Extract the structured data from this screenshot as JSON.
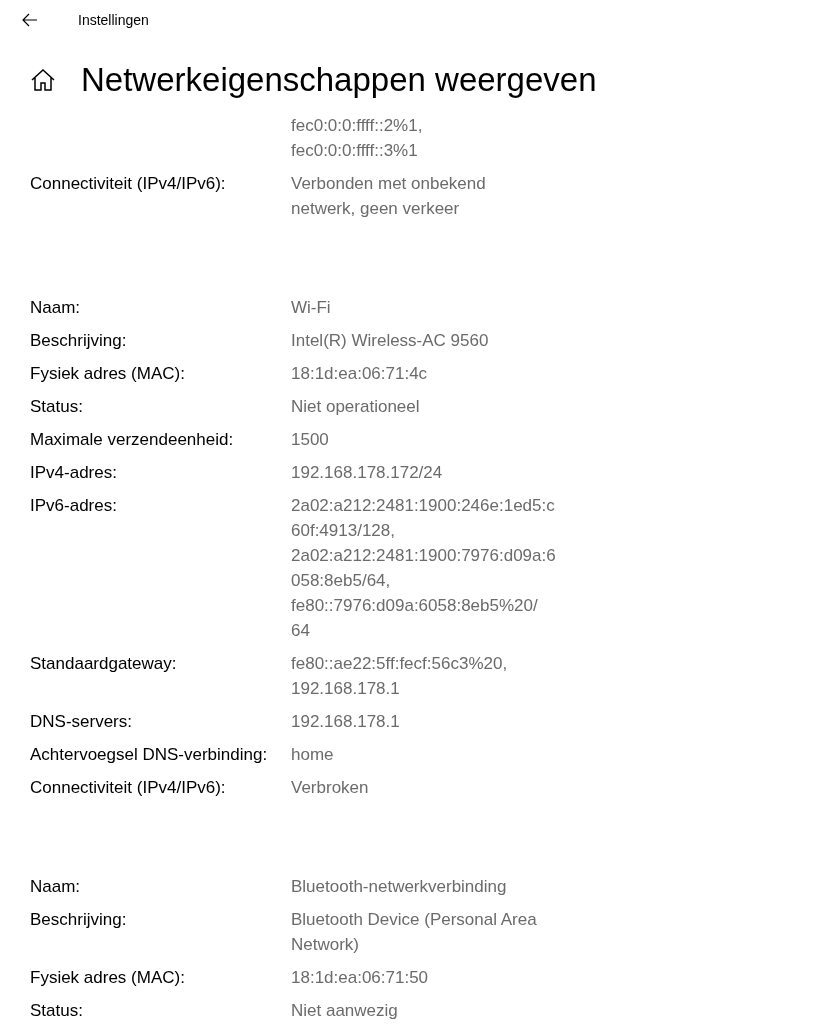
{
  "header": {
    "back_label": "Instellingen"
  },
  "page": {
    "title": "Netwerkeigenschappen weergeven"
  },
  "sections": [
    {
      "rows": [
        {
          "label": "",
          "value": [
            "fec0:0:0:ffff::2%1,",
            "fec0:0:0:ffff::3%1"
          ]
        },
        {
          "label": "Connectiviteit (IPv4/IPv6):",
          "value": [
            "Verbonden met onbekend",
            "netwerk, geen verkeer"
          ]
        }
      ]
    },
    {
      "rows": [
        {
          "label": "Naam:",
          "value": [
            "Wi-Fi"
          ]
        },
        {
          "label": "Beschrijving:",
          "value": [
            "Intel(R) Wireless-AC 9560"
          ]
        },
        {
          "label": "Fysiek adres (MAC):",
          "value": [
            "18:1d:ea:06:71:4c"
          ]
        },
        {
          "label": "Status:",
          "value": [
            "Niet operationeel"
          ]
        },
        {
          "label": "Maximale verzendeenheid:",
          "value": [
            "1500"
          ]
        },
        {
          "label": "IPv4-adres:",
          "value": [
            "192.168.178.172/24"
          ]
        },
        {
          "label": "IPv6-adres:",
          "value": [
            "2a02:a212:2481:1900:246e:1ed5:c",
            "60f:4913/128,",
            "2a02:a212:2481:1900:7976:d09a:6",
            "058:8eb5/64,",
            "fe80::7976:d09a:6058:8eb5%20/",
            "64"
          ]
        },
        {
          "label": "Standaardgateway:",
          "value": [
            "fe80::ae22:5ff:fecf:56c3%20,",
            "192.168.178.1"
          ]
        },
        {
          "label": "DNS-servers:",
          "value": [
            "192.168.178.1"
          ]
        },
        {
          "label": "Achtervoegsel DNS-verbinding:",
          "value": [
            "home"
          ]
        },
        {
          "label": "Connectiviteit (IPv4/IPv6):",
          "value": [
            "Verbroken"
          ]
        }
      ]
    },
    {
      "rows": [
        {
          "label": "Naam:",
          "value": [
            "Bluetooth-netwerkverbinding"
          ]
        },
        {
          "label": "Beschrijving:",
          "value": [
            "Bluetooth Device (Personal Area",
            "Network)"
          ]
        },
        {
          "label": "Fysiek adres (MAC):",
          "value": [
            "18:1d:ea:06:71:50"
          ]
        },
        {
          "label": "Status:",
          "value": [
            "Niet aanwezig"
          ]
        }
      ]
    }
  ]
}
